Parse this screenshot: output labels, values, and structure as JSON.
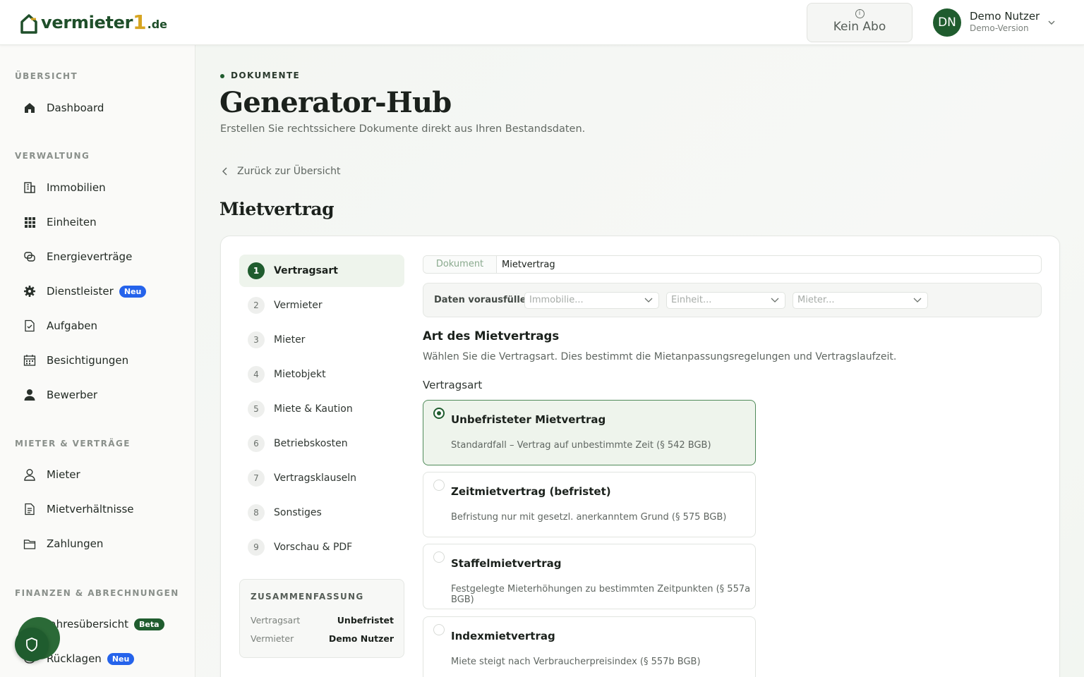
{
  "header": {
    "logo": {
      "name": "vermieter",
      "digit": "1",
      "tld": ".de"
    },
    "abo": {
      "label": "Kein Abo",
      "icon": "info-icon"
    },
    "user": {
      "initials": "DN",
      "name": "Demo Nutzer",
      "subtitle": "Demo-Version"
    }
  },
  "sidebar": {
    "sections": [
      {
        "label": "ÜBERSICHT",
        "items": [
          {
            "label": "Dashboard",
            "icon": "home-icon"
          }
        ]
      },
      {
        "label": "VERWALTUNG",
        "items": [
          {
            "label": "Immobilien",
            "icon": "building-icon"
          },
          {
            "label": "Einheiten",
            "icon": "grid-icon"
          },
          {
            "label": "Energieverträge",
            "icon": "energy-contract-icon"
          },
          {
            "label": "Dienstleister",
            "icon": "gear-icon",
            "badge": "Neu"
          },
          {
            "label": "Aufgaben",
            "icon": "task-icon"
          },
          {
            "label": "Besichtigungen",
            "icon": "calendar-icon"
          },
          {
            "label": "Bewerber",
            "icon": "user-solid-icon"
          }
        ]
      },
      {
        "label": "MIETER & VERTRÄGE",
        "items": [
          {
            "label": "Mieter",
            "icon": "user-icon"
          },
          {
            "label": "Mietverhältnisse",
            "icon": "document-icon"
          },
          {
            "label": "Zahlungen",
            "icon": "wallet-icon"
          }
        ]
      },
      {
        "label": "FINANZEN & ABRECHNUNGEN",
        "items": [
          {
            "label": "Jahresübersicht",
            "icon": "chart-icon",
            "badge": "Beta"
          },
          {
            "label": "Rücklagen",
            "icon": "savings-icon",
            "badge": "Neu"
          }
        ]
      }
    ]
  },
  "page": {
    "eyebrow": "DOKUMENTE",
    "title": "Generator-Hub",
    "subtitle": "Erstellen Sie rechtssichere Dokumente direkt aus Ihren Bestandsdaten.",
    "back_label": "Zurück zur Übersicht",
    "section_title": "Mietvertrag"
  },
  "wizard": {
    "steps": [
      {
        "num": "1",
        "label": "Vertragsart",
        "active": true
      },
      {
        "num": "2",
        "label": "Vermieter"
      },
      {
        "num": "3",
        "label": "Mieter"
      },
      {
        "num": "4",
        "label": "Mietobjekt"
      },
      {
        "num": "5",
        "label": "Miete & Kaution"
      },
      {
        "num": "6",
        "label": "Betriebskosten"
      },
      {
        "num": "7",
        "label": "Vertragsklauseln"
      },
      {
        "num": "8",
        "label": "Sonstiges"
      },
      {
        "num": "9",
        "label": "Vorschau & PDF"
      }
    ],
    "summary": {
      "title": "ZUSAMMENFASSUNG",
      "rows": [
        {
          "key": "Vertragsart",
          "value": "Unbefristet"
        },
        {
          "key": "Vermieter",
          "value": "Demo Nutzer"
        }
      ]
    },
    "document": {
      "tag": "Dokument",
      "value": "Mietvertrag"
    },
    "prefill": {
      "label": "Daten vorausfüllen:",
      "selects": [
        {
          "placeholder": "Immobilie..."
        },
        {
          "placeholder": "Einheit..."
        },
        {
          "placeholder": "Mieter..."
        }
      ]
    },
    "heading": "Art des Mietvertrags",
    "description": "Wählen Sie die Vertragsart. Dies bestimmt die Mietanpassungsregelungen und Vertragslaufzeit.",
    "field_label": "Vertragsart",
    "options": [
      {
        "title": "Unbefristeter Mietvertrag",
        "desc": "Standardfall – Vertrag auf unbestimmte Zeit (§ 542 BGB)",
        "selected": true
      },
      {
        "title": "Zeitmietvertrag (befristet)",
        "desc": "Befristung nur mit gesetzl. anerkanntem Grund (§ 575 BGB)"
      },
      {
        "title": "Staffelmietvertrag",
        "desc": "Festgelegte Mieterhöhungen zu bestimmten Zeitpunkten (§ 557a BGB)"
      },
      {
        "title": "Indexmietvertrag",
        "desc": "Miete steigt nach Verbraucherpreisindex (§ 557b BGB)"
      }
    ]
  },
  "colors": {
    "brand_green": "#1f5c2e",
    "brand_gold": "#d7a521",
    "badge_neu": "#2563eb",
    "badge_beta": "#1f5c2e"
  }
}
